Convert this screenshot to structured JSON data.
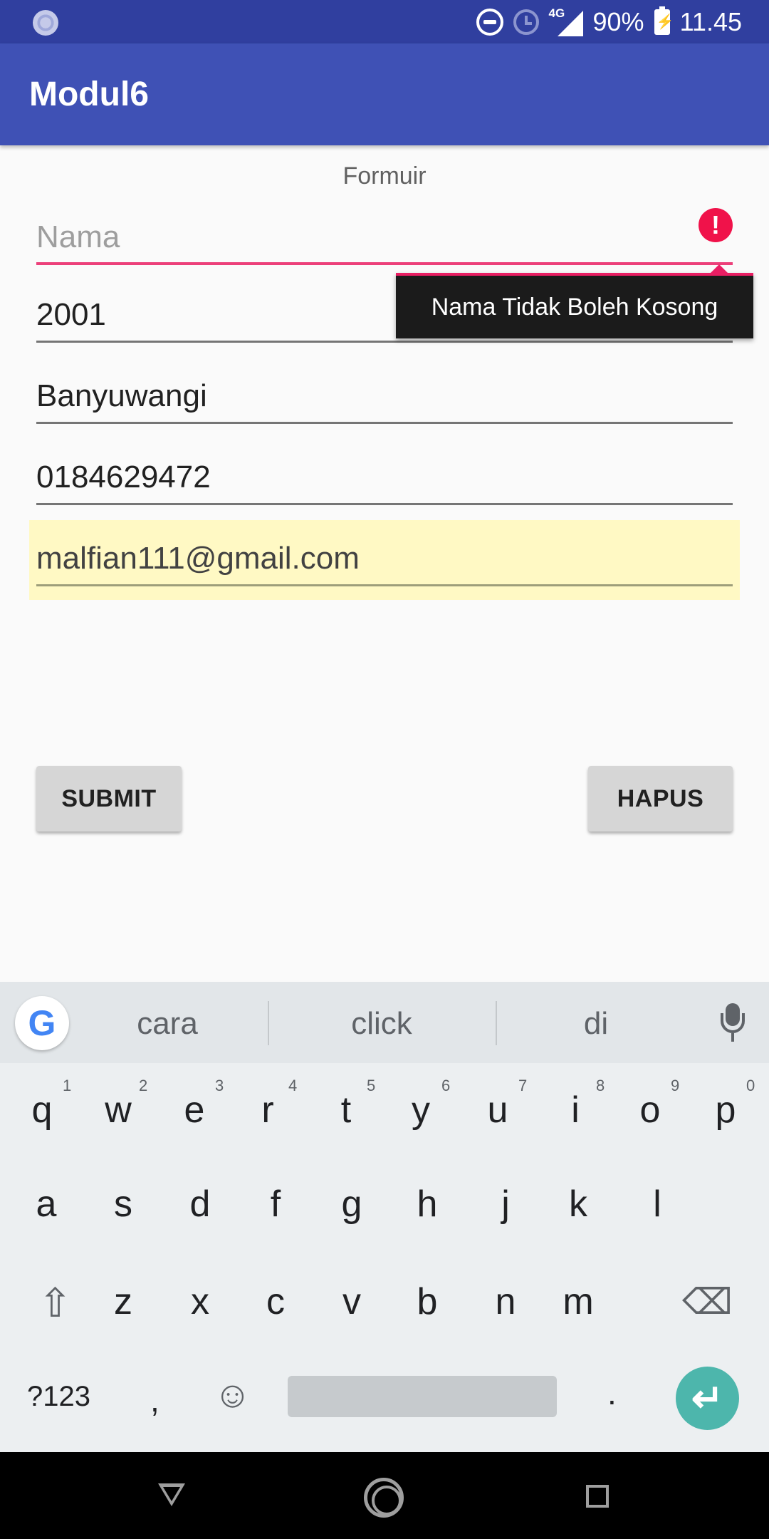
{
  "status_bar": {
    "network": "4G",
    "battery": "90%",
    "time": "11.45"
  },
  "app_bar": {
    "title": "Modul6"
  },
  "form": {
    "title": "Formuir",
    "name_hint": "Nama",
    "year": "2001",
    "city": "Banyuwangi",
    "phone": "0184629472",
    "email": "malfian111@gmail.com",
    "error_message": "Nama Tidak Boleh Kosong",
    "submit_label": "SUBMIT",
    "clear_label": "HAPUS"
  },
  "keyboard": {
    "suggestions": [
      "cara",
      "click",
      "di"
    ],
    "row1": [
      "q",
      "w",
      "e",
      "r",
      "t",
      "y",
      "u",
      "i",
      "o",
      "p"
    ],
    "row1_hints": [
      "1",
      "2",
      "3",
      "4",
      "5",
      "6",
      "7",
      "8",
      "9",
      "0"
    ],
    "row2": [
      "a",
      "s",
      "d",
      "f",
      "g",
      "h",
      "j",
      "k",
      "l"
    ],
    "row3": [
      "z",
      "x",
      "c",
      "v",
      "b",
      "n",
      "m"
    ],
    "symbols_label": "?123",
    "comma": ",",
    "period": ".",
    "google_logo": "G"
  },
  "colors": {
    "primary": "#3f51b5",
    "primary_dark": "#303f9f",
    "error": "#f0124a",
    "accent_line": "#ec407a",
    "enter_key": "#4db6ac",
    "autofill": "#fff9c4"
  }
}
